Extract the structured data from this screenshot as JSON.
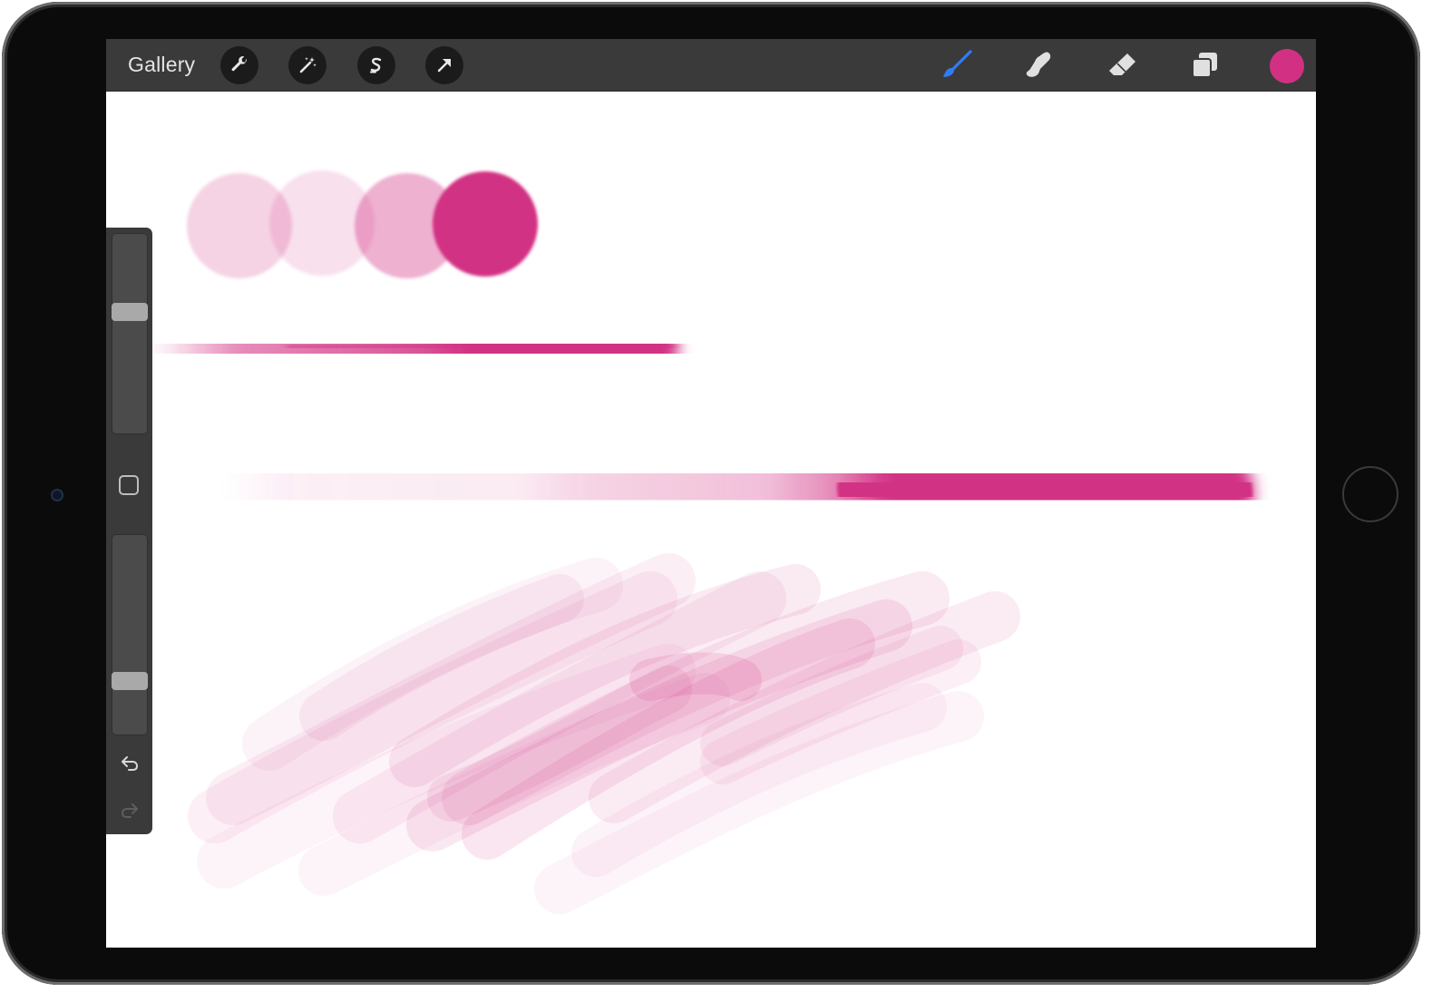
{
  "toolbar": {
    "gallery_label": "Gallery",
    "left_tools": [
      {
        "name": "actions",
        "icon": "wrench-icon"
      },
      {
        "name": "adjustments",
        "icon": "magic-wand-icon"
      },
      {
        "name": "selection",
        "icon": "selection-s-icon"
      },
      {
        "name": "transform",
        "icon": "arrow-cursor-icon"
      }
    ],
    "right_tools": [
      {
        "name": "brush",
        "icon": "paintbrush-icon",
        "active": true
      },
      {
        "name": "smudge",
        "icon": "smudge-finger-icon",
        "active": false
      },
      {
        "name": "eraser",
        "icon": "eraser-icon",
        "active": false
      },
      {
        "name": "layers",
        "icon": "layers-icon",
        "active": false
      }
    ],
    "current_color": "#d23183"
  },
  "sidebar": {
    "brush_size_level": 0.62,
    "opacity_level": 0.25,
    "modify_icon": "square-icon",
    "undo_icon": "undo-arrow-icon",
    "redo_icon": "redo-arrow-icon"
  },
  "colors": {
    "active_tool": "#2f7df6",
    "paint": "#d23183",
    "toolbar_bg": "#3a3a3b"
  }
}
